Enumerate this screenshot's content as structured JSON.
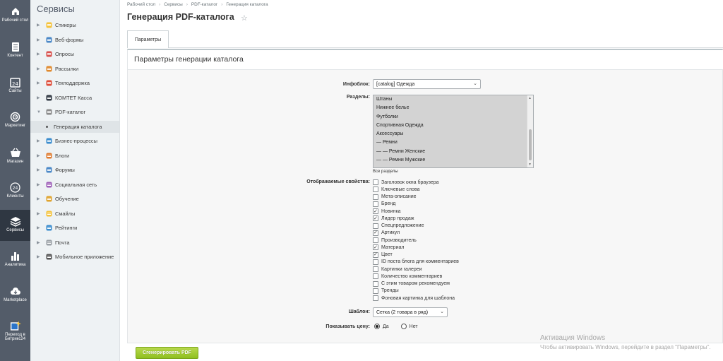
{
  "rail": [
    {
      "label": "Рабочий стол",
      "icon": "home-icon"
    },
    {
      "label": "Контент",
      "icon": "document-icon"
    },
    {
      "label": "Сайты",
      "icon": "calendar-24-icon"
    },
    {
      "label": "Маркетинг",
      "icon": "target-icon"
    },
    {
      "label": "Магазин",
      "icon": "basket-icon"
    },
    {
      "label": "Клиенты",
      "icon": "clients-24-icon"
    },
    {
      "label": "Сервисы",
      "icon": "layers-icon"
    },
    {
      "label": "Аналитика",
      "icon": "bar-chart-icon"
    },
    {
      "label": "Marketplace",
      "icon": "cloud-download-icon"
    },
    {
      "label": "Переход в Битрикс24",
      "icon": "bitrix-arrow-icon"
    }
  ],
  "menu": {
    "title": "Сервисы",
    "items": [
      {
        "label": "Стикеры",
        "icon": "sticker-icon",
        "color": "#f5c33b"
      },
      {
        "label": "Веб-формы",
        "icon": "form-icon",
        "color": "#4b88c7"
      },
      {
        "label": "Опросы",
        "icon": "poll-icon",
        "color": "#d9534f"
      },
      {
        "label": "Рассылки",
        "icon": "mail-icon",
        "color": "#e08a2f"
      },
      {
        "label": "Техподдержка",
        "icon": "support-icon",
        "color": "#e04e3a"
      },
      {
        "label": "КОМТЕТ Касса",
        "icon": "cashbox-icon",
        "color": "#2f3742"
      },
      {
        "label": "PDF-каталог",
        "icon": "pdf-icon",
        "color": "#8c8c8c",
        "expanded": true
      },
      {
        "label": "Генерация каталога",
        "sub": true
      },
      {
        "label": "Бизнес-процессы",
        "icon": "process-icon",
        "color": "#3c8dce"
      },
      {
        "label": "Блоги",
        "icon": "blog-icon",
        "color": "#e07b2f"
      },
      {
        "label": "Форумы",
        "icon": "forum-icon",
        "color": "#4b88c7"
      },
      {
        "label": "Социальная сеть",
        "icon": "social-icon",
        "color": "#9e5fb8"
      },
      {
        "label": "Обучение",
        "icon": "learning-icon",
        "color": "#e0a42f"
      },
      {
        "label": "Смайлы",
        "icon": "smile-icon",
        "color": "#f5c33b"
      },
      {
        "label": "Рейтинги",
        "icon": "rating-icon",
        "color": "#3c8dce"
      },
      {
        "label": "Почта",
        "icon": "mailbox-icon",
        "color": "#9aa0a6"
      },
      {
        "label": "Мобильное приложение",
        "icon": "mobile-icon",
        "color": "#555"
      }
    ]
  },
  "breadcrumbs": [
    "Рабочий стол",
    "Сервисы",
    "PDF-каталог",
    "Генерация каталога"
  ],
  "page_title": "Генерация PDF-каталога",
  "tabs": [
    {
      "label": "Параметры"
    }
  ],
  "panel_title": "Параметры генерации каталога",
  "form": {
    "iblock_label": "Инфоблок:",
    "iblock_value": "[catalog] Одежда",
    "sections_label": "Разделы:",
    "sections": [
      "Штаны",
      "Нижнее белье",
      "Футболки",
      "Спортивная Одежда",
      "Аксессуары",
      "— Ремни",
      "— — Ремни Женские",
      "— — Ремни Мужские"
    ],
    "all_sections": "Все разделы",
    "props_label": "Отображаемые свойства:",
    "props": [
      {
        "label": "Заголовок окна браузера",
        "checked": false
      },
      {
        "label": "Ключевые слова",
        "checked": false
      },
      {
        "label": "Мета-описание",
        "checked": false
      },
      {
        "label": "Бренд",
        "checked": false
      },
      {
        "label": "Новинка",
        "checked": true
      },
      {
        "label": "Лидер продаж",
        "checked": true
      },
      {
        "label": "Спецпредложение",
        "checked": false
      },
      {
        "label": "Артикул",
        "checked": true
      },
      {
        "label": "Производитель",
        "checked": false
      },
      {
        "label": "Материал",
        "checked": true
      },
      {
        "label": "Цвет",
        "checked": true
      },
      {
        "label": "ID поста блога для комментариев",
        "checked": false
      },
      {
        "label": "Картинки галереи",
        "checked": false
      },
      {
        "label": "Количество комментариев",
        "checked": false
      },
      {
        "label": "С этим товаром рекомендуем",
        "checked": false
      },
      {
        "label": "Тренды",
        "checked": false
      },
      {
        "label": "Фоновая картинка для шаблона",
        "checked": false
      }
    ],
    "template_label": "Шаблон:",
    "template_value": "Сетка (2 товара в ряд)",
    "price_label": "Показывать цену:",
    "price_yes": "Да",
    "price_no": "Нет",
    "price_selected": "yes",
    "generate_label": "Сгенерировать PDF"
  },
  "windows_activation": {
    "title": "Активация Windows",
    "subtitle": "Чтобы активировать Windows, перейдите в раздел \"Параметры\"."
  }
}
